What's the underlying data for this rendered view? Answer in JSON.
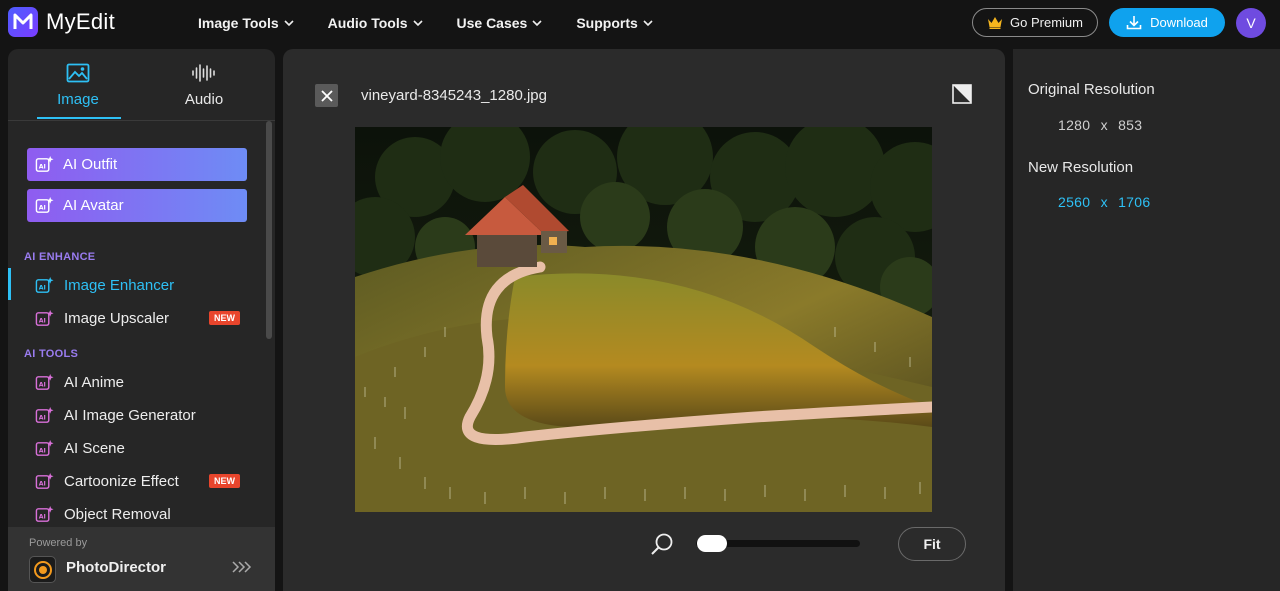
{
  "app": {
    "name": "MyEdit"
  },
  "nav": {
    "items": [
      {
        "label": "Image Tools"
      },
      {
        "label": "Audio Tools"
      },
      {
        "label": "Use Cases"
      },
      {
        "label": "Supports"
      }
    ],
    "premium_label": "Go Premium",
    "download_label": "Download",
    "avatar_initial": "V"
  },
  "sidebar": {
    "tabs": [
      {
        "label": "Image"
      },
      {
        "label": "Audio"
      }
    ],
    "active_tab": "Image",
    "featured": [
      {
        "label": "AI Outfit"
      },
      {
        "label": "AI Avatar"
      }
    ],
    "sections": [
      {
        "title": "AI ENHANCE",
        "items": [
          {
            "label": "Image Enhancer",
            "active": true
          },
          {
            "label": "Image Upscaler",
            "badge": "NEW"
          }
        ]
      },
      {
        "title": "AI TOOLS",
        "items": [
          {
            "label": "AI Anime"
          },
          {
            "label": "AI Image Generator"
          },
          {
            "label": "AI Scene"
          },
          {
            "label": "Cartoonize Effect",
            "badge": "NEW"
          },
          {
            "label": "Object Removal"
          }
        ]
      }
    ],
    "footer": {
      "powered_by": "Powered by",
      "product": "PhotoDirector"
    }
  },
  "editor": {
    "file_name": "vineyard-8345243_1280.jpg",
    "zoom_level": 0,
    "fit_label": "Fit"
  },
  "resolution": {
    "original_label": "Original Resolution",
    "original_width": "1280",
    "original_height": "853",
    "new_label": "New Resolution",
    "new_width": "2560",
    "new_height": "1706",
    "separator": "x"
  },
  "colors": {
    "accent": "#2ec0f5",
    "download": "#0fa2ee",
    "badge_new": "#e8452c",
    "section_label": "#9a7cf0",
    "avatar": "#6f4be0"
  }
}
